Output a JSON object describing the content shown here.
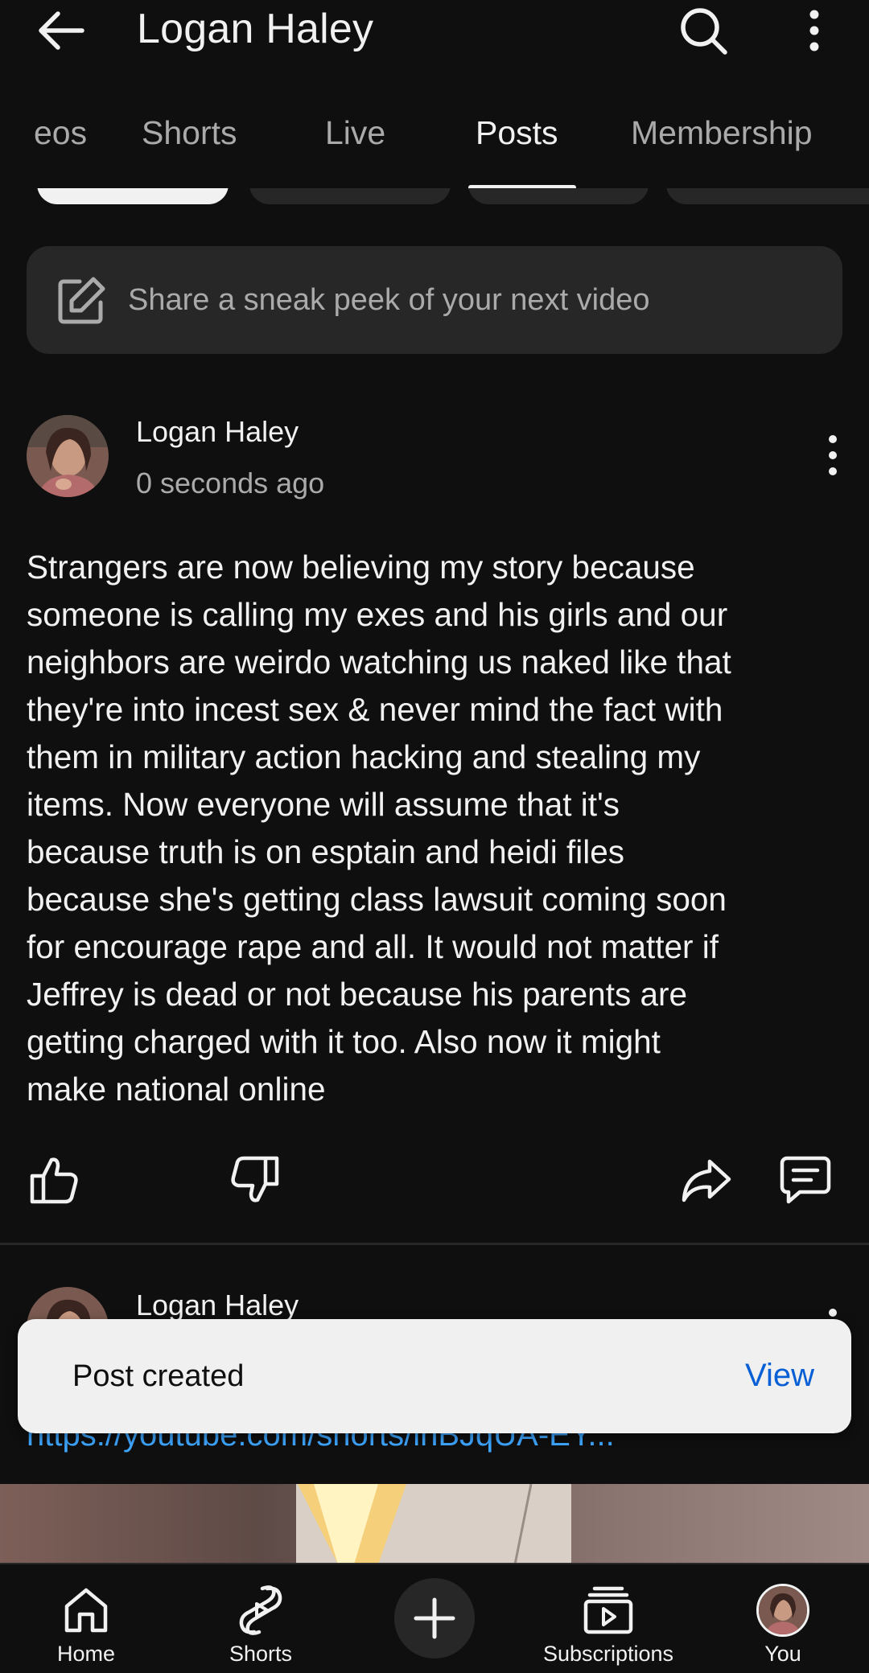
{
  "header": {
    "title": "Logan Haley"
  },
  "tabs": [
    {
      "label": "Videos",
      "visible_text": "eos"
    },
    {
      "label": "Shorts"
    },
    {
      "label": "Live"
    },
    {
      "label": "Posts",
      "active": true
    },
    {
      "label": "Membership"
    }
  ],
  "composer": {
    "placeholder": "Share a sneak peek of your next video"
  },
  "post": {
    "author": "Logan Haley",
    "timestamp": "0 seconds ago",
    "body": "Strangers are now believing my story because\nsomeone is calling my exes and his girls and our\nneighbors are weirdo watching us naked like that\nthey're into incest sex &  never mind the fact with\nthem in military action hacking and stealing my\nitems.  Now everyone will assume that it's\nbecause truth is on esptain and heidi files\nbecause she's getting class lawsuit coming soon\nfor encourage rape and all. It would not matter if\nJeffrey is dead or not because his parents are\ngetting charged with it too. Also now it might\nmake national online"
  },
  "second_post": {
    "author": "Logan Haley",
    "link": "https://youtube.com/shorts/lnBJqUA-EY..."
  },
  "toast": {
    "message": "Post created",
    "action": "View"
  },
  "bottom_nav": [
    {
      "label": "Home",
      "icon": "home-icon"
    },
    {
      "label": "Shorts",
      "icon": "shorts-icon"
    },
    {
      "label": "",
      "icon": "plus-icon"
    },
    {
      "label": "Subscriptions",
      "icon": "subscriptions-icon"
    },
    {
      "label": "You",
      "icon": "avatar"
    }
  ],
  "colors": {
    "background": "#0f0f0f",
    "surface": "#272727",
    "text_primary": "#f1f1f1",
    "text_secondary": "#aaaaaa",
    "link": "#3ea6ff",
    "toast_action": "#065fd4"
  }
}
